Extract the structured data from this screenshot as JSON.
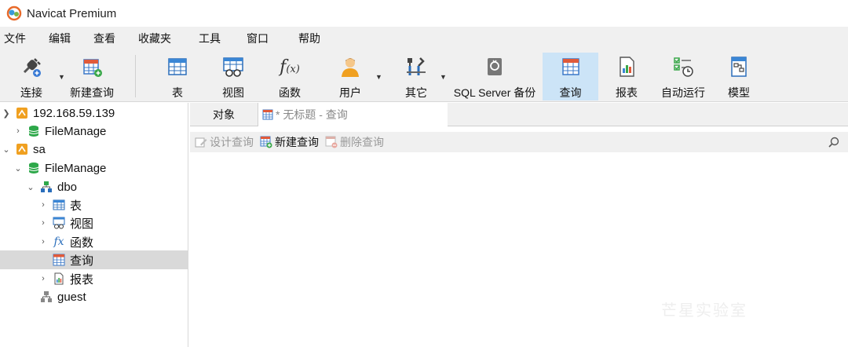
{
  "window": {
    "title": "Navicat Premium"
  },
  "menu": [
    "文件",
    "编辑",
    "查看",
    "收藏夹",
    "工具",
    "窗口",
    "帮助"
  ],
  "toolbar": {
    "connect": "连接",
    "new_query": "新建查询",
    "table": "表",
    "view": "视图",
    "function": "函数",
    "user": "用户",
    "other": "其它",
    "backup": "SQL Server 备份",
    "query": "查询",
    "report": "报表",
    "automation": "自动运行",
    "model": "模型"
  },
  "tree": {
    "server1": "192.168.59.139",
    "server1_db": "FileManage",
    "server2": "sa",
    "server2_db": "FileManage",
    "schema": "dbo",
    "tables": "表",
    "views": "视图",
    "functions": "函数",
    "queries": "查询",
    "reports": "报表",
    "guest": "guest"
  },
  "tabs": {
    "objects": "对象",
    "query_tab": "* 无标题 - 查询"
  },
  "subtoolbar": {
    "design": "设计查询",
    "new": "新建查询",
    "delete": "删除查询"
  },
  "watermark": "芒星实验室",
  "colors": {
    "active_tool": "#cce4f7",
    "selected_row": "#d9d9d9",
    "chrome": "#f0f0f0"
  }
}
